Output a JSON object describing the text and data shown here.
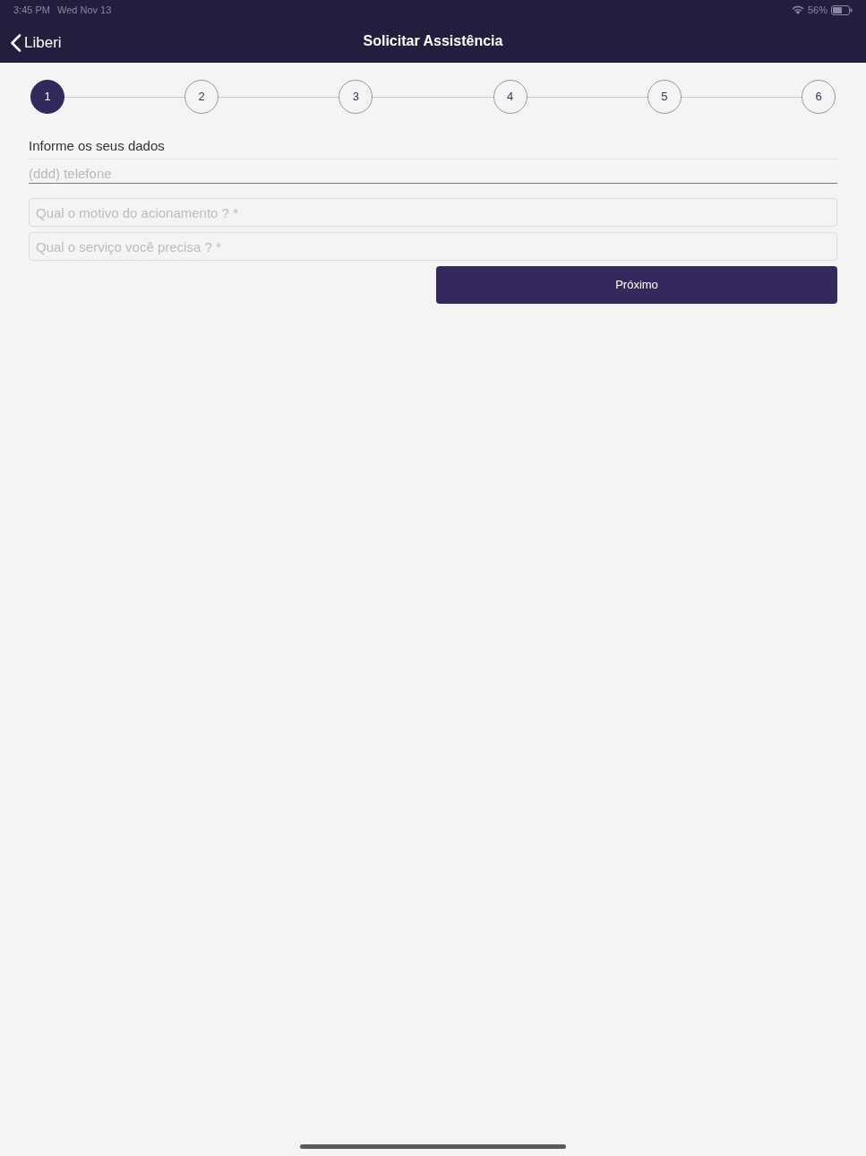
{
  "status_bar": {
    "time": "3:45 PM",
    "date": "Wed Nov 13",
    "battery": "56%"
  },
  "nav_bar": {
    "back_label": "Liberi",
    "title": "Solicitar Assistência"
  },
  "stepper": [
    {
      "label": "1",
      "selected": true
    },
    {
      "label": "2",
      "selected": false
    },
    {
      "label": "3",
      "selected": false
    },
    {
      "label": "4",
      "selected": false
    },
    {
      "label": "5",
      "selected": false
    },
    {
      "label": "6",
      "selected": false
    }
  ],
  "form": {
    "section_title": "Informe os seus dados",
    "fields": [
      {
        "kind": "underline",
        "placeholder": "(ddd) telefone"
      },
      {
        "kind": "boxed",
        "placeholder": "Qual o motivo do acionamento ? *"
      },
      {
        "kind": "boxed",
        "placeholder": "Qual o serviço você precisa ? *"
      }
    ],
    "submit_button": "Próximo"
  }
}
